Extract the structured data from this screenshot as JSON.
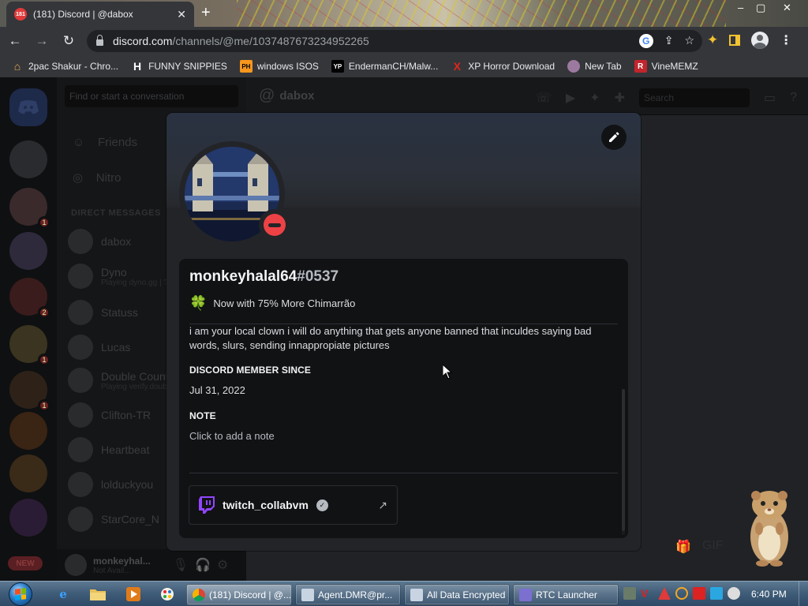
{
  "browser": {
    "tab_title": "(181) Discord | @dabox",
    "tab_badge": "181",
    "url_host": "discord.com",
    "url_path": "/channels/@me/1037487673234952265",
    "bookmarks": [
      {
        "label": "2pac Shakur - Chro...",
        "icon": "shop-icon",
        "color": "#e8b04a"
      },
      {
        "label": "FUNNY SNIPPIES",
        "icon": "H",
        "color": "#ffffff"
      },
      {
        "label": "windows ISOS",
        "icon": "PH",
        "color": "#f7971d"
      },
      {
        "label": "EndermanCH/Malw...",
        "icon": "YP",
        "color": "#222222"
      },
      {
        "label": "XP Horror Download",
        "icon": "X",
        "color": "#e0261b"
      },
      {
        "label": "New Tab",
        "icon": "globe-icon",
        "color": "#9c7aa0"
      },
      {
        "label": "VineMEMZ",
        "icon": "R",
        "color": "#c2252c"
      }
    ]
  },
  "discord_bg": {
    "search_placeholder": "Find or start a conversation",
    "nav": [
      "Friends",
      "Nitro"
    ],
    "dm_header": "DIRECT MESSAGES",
    "dms": [
      {
        "name": "dabox",
        "sub": ""
      },
      {
        "name": "Dyno",
        "sub": "Playing dyno.gg | ?help"
      },
      {
        "name": "Statuss",
        "sub": ""
      },
      {
        "name": "Lucas",
        "sub": ""
      },
      {
        "name": "Double Counter",
        "sub": "Playing verify.doublecounter"
      },
      {
        "name": "Clifton-TR",
        "sub": ""
      },
      {
        "name": "Heartbeat",
        "sub": ""
      },
      {
        "name": "lolduckyou",
        "sub": ""
      },
      {
        "name": "StarCore_N",
        "sub": ""
      }
    ],
    "channel_name": "dabox",
    "header_search": "Search",
    "user_name": "monkeyhal...",
    "user_sub": "Not Avail...",
    "new_pill": "NEW"
  },
  "profile": {
    "username": "monkeyhalal64",
    "discriminator": "#0537",
    "custom_status": "Now with 75% More Chimarrão",
    "status_emoji": "🍀",
    "bio": "i am your local clown i will do anything that gets anyone banned that inculdes saying bad words, slurs, sending innappropiate pictures",
    "member_since_title": "DISCORD MEMBER SINCE",
    "member_since": "Jul 31, 2022",
    "note_title": "NOTE",
    "note_placeholder": "Click to add a note",
    "connection": {
      "name": "twitch_collabvm",
      "service": "twitch",
      "color": "#9146ff",
      "verified": true
    },
    "status": "do-not-disturb",
    "status_color": "#ed4245"
  },
  "taskbar": {
    "tasks": [
      {
        "label": "(181) Discord | @...",
        "icon": "chrome-icon",
        "active": true
      },
      {
        "label": "Agent.DMR@pr...",
        "icon": "window-icon",
        "active": false
      },
      {
        "label": "All Data Encrypted",
        "icon": "window-icon",
        "active": false
      },
      {
        "label": "RTC Launcher",
        "icon": "rtc-icon",
        "active": false
      }
    ],
    "clock": "6:40 PM"
  }
}
